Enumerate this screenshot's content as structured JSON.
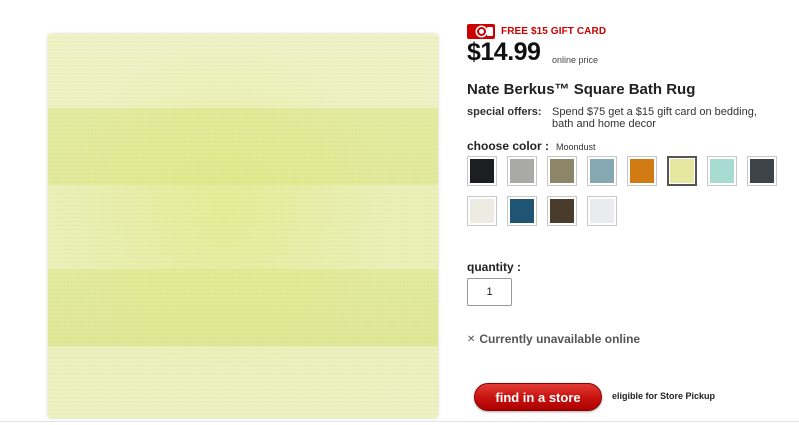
{
  "product": {
    "image_alt": "Nate Berkus Square Bath Rug in Moondust",
    "promo_badge": "FREE $15 GIFT CARD",
    "price": "$14.99",
    "price_note": "online price",
    "title": "Nate Berkus™ Square Bath Rug"
  },
  "offers": {
    "label": "special offers:",
    "text": "Spend $75 get a $15 gift card on bedding, bath and home decor"
  },
  "color": {
    "label": "choose color :",
    "selected": "Moondust",
    "swatches": [
      {
        "color": "#1c1e22"
      },
      {
        "color": "#a9a9a7"
      },
      {
        "color": "#8c8568"
      },
      {
        "color": "#86a8b3"
      },
      {
        "color": "#d07b14"
      },
      {
        "color": "#e6e8a1"
      },
      {
        "color": "#a8dcd2"
      },
      {
        "color": "#3d4347"
      },
      {
        "color": "#ecece2"
      },
      {
        "color": "#1f5573"
      },
      {
        "color": "#4a3c2c"
      },
      {
        "color": "#eaebee"
      }
    ]
  },
  "quantity": {
    "label": "quantity :",
    "value": "1"
  },
  "availability": {
    "icon": "close-icon",
    "text": "Currently unavailable online"
  },
  "store": {
    "button_label": "find in a store",
    "pickup_text": "eligible for Store Pickup"
  },
  "colors": {
    "accent": "#cc0000"
  }
}
